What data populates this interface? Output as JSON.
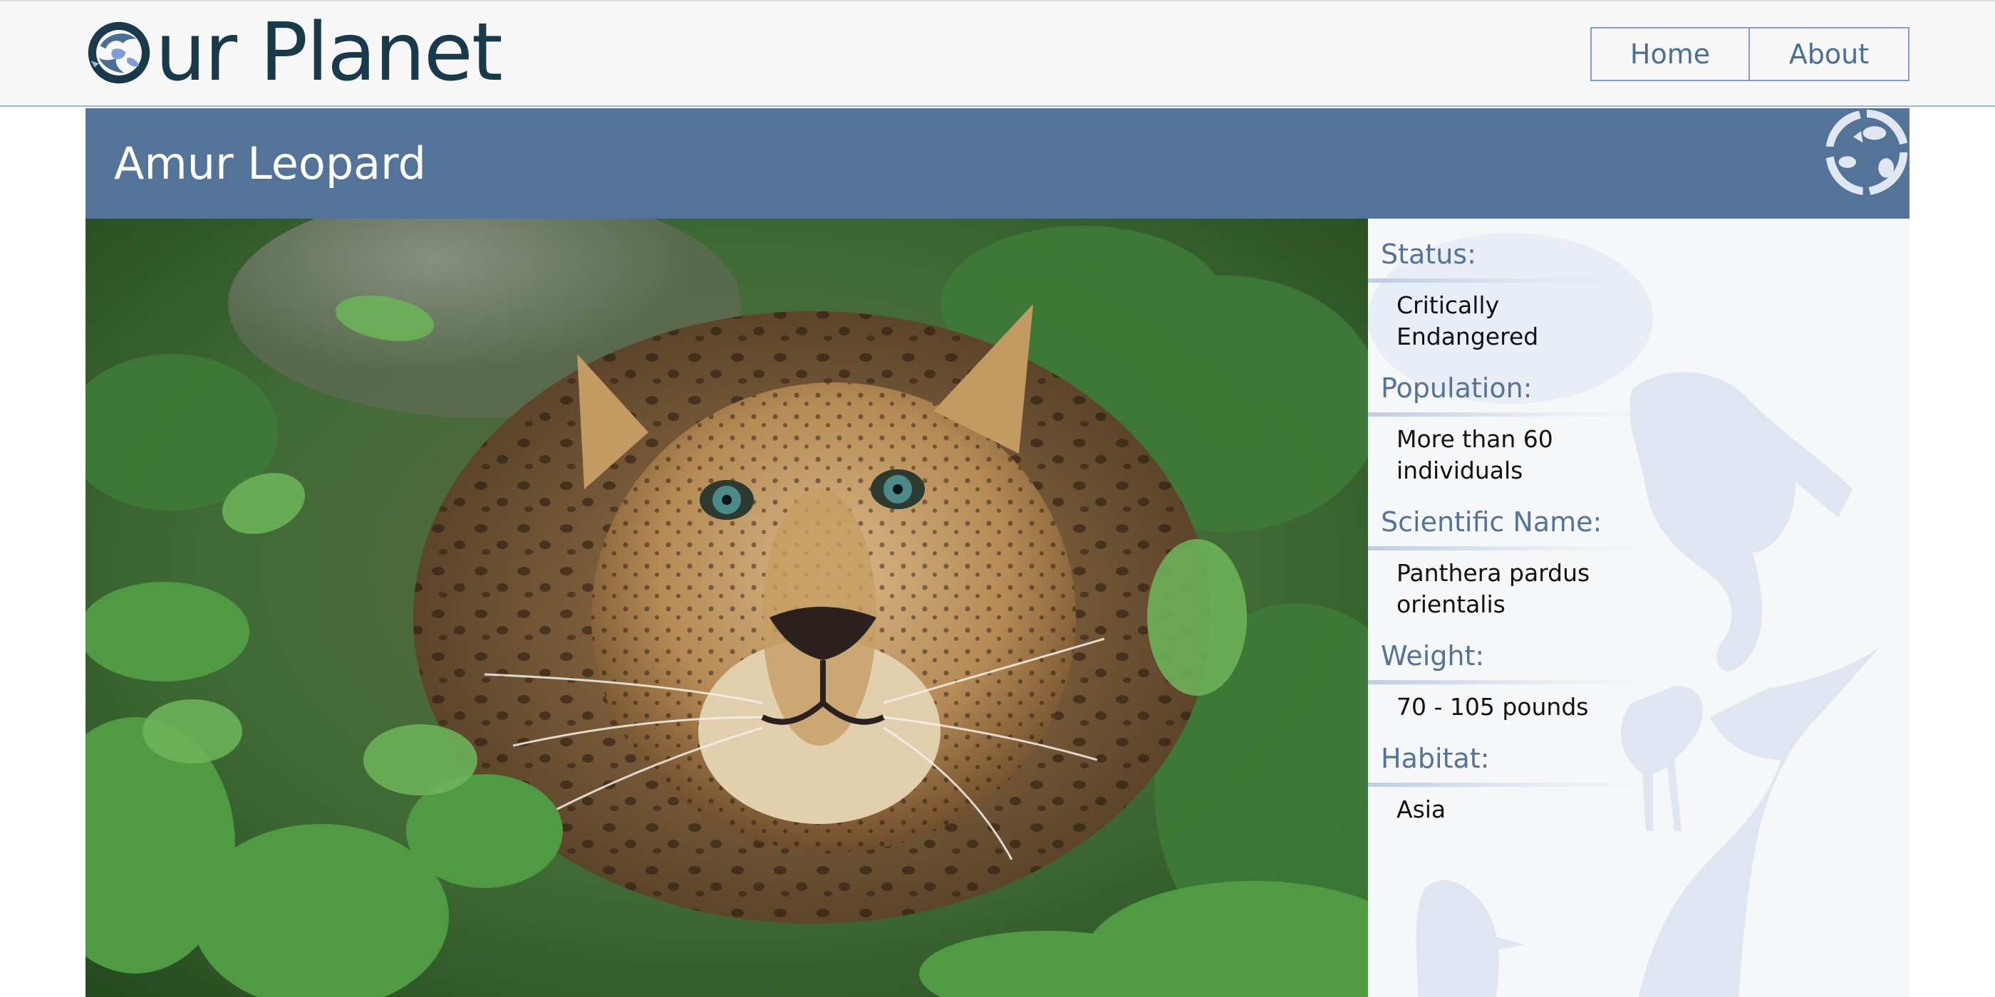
{
  "header": {
    "logo_text": "ur Planet",
    "logo_icon": "globe-animals-icon",
    "nav": [
      {
        "label": "Home"
      },
      {
        "label": "About"
      }
    ]
  },
  "page": {
    "title": "Amur Leopard",
    "title_icon": "globe-animals-icon"
  },
  "photo": {
    "subject": "amur-leopard-photo"
  },
  "info": {
    "fields": [
      {
        "label": "Status:",
        "value": "Critically Endangered"
      },
      {
        "label": "Population:",
        "value": "More than 60 individuals"
      },
      {
        "label": "Scientific Name:",
        "value": "Panthera pardus orientalis"
      },
      {
        "label": "Weight:",
        "value": "70 - 105 pounds"
      },
      {
        "label": "Habitat:",
        "value": "Asia"
      }
    ]
  },
  "colors": {
    "header_bg": "#f7f7f7",
    "logo_text": "#183a4b",
    "title_bar": "#547399",
    "nav_border": "#7d9ed6",
    "label_text": "#547399"
  }
}
